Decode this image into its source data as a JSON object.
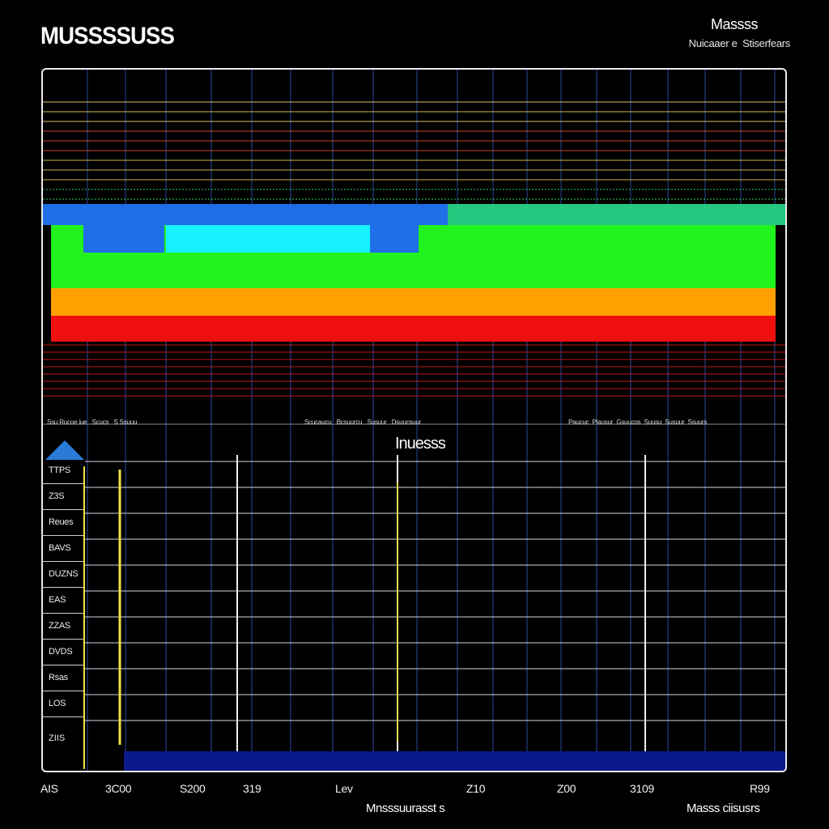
{
  "header": {
    "app_title": "MUSSSSUSS",
    "right_title": "Massss",
    "right_subtitle": "Nuicaaer e  Stiserfears"
  },
  "panel": {
    "inner_title": "Inuesss",
    "label_row_left": [
      "Ssu Rucoe iue",
      "Scucs",
      "S Ssuuu"
    ],
    "label_row_mid": [
      "Scucaucu",
      "Bcsuurcu",
      "Susuur",
      "Dsuucsuur"
    ],
    "label_row_right": [
      "Paucuc",
      "Plausur",
      "Gsuucos",
      "Suusu",
      "Susuur",
      "Ssuurs"
    ],
    "side_legend": [
      "TTPS",
      "Z3S",
      "Reues",
      "BAVS",
      "DUZNS",
      "EAS",
      "ZZAS",
      "DVDS",
      "Rsas",
      "LOS"
    ],
    "side_bottom": "ZIIS"
  },
  "x_axis": {
    "ticks": [
      "AIS",
      "3C00",
      "S200",
      "319",
      "Lev",
      "Z10",
      "Z00",
      "3109",
      "R99"
    ],
    "label_center": "Mnsssuurasst s",
    "label_right": "Masss ciisusrs"
  },
  "colors": {
    "background": "#000000",
    "panel_border": "#eaeaea",
    "grid_line": "#2b4aa0",
    "band_blue": "#1e6fe8",
    "band_cyan": "#17f0ff",
    "band_green": "#22f21e",
    "band_orange": "#ffa000",
    "band_red": "#f01010",
    "trace_yellow": "#f2e24a",
    "floor_blue": "#0a1a8c",
    "triangle": "#2a7ad8"
  },
  "icons": [
    "up-triangle-icon"
  ]
}
